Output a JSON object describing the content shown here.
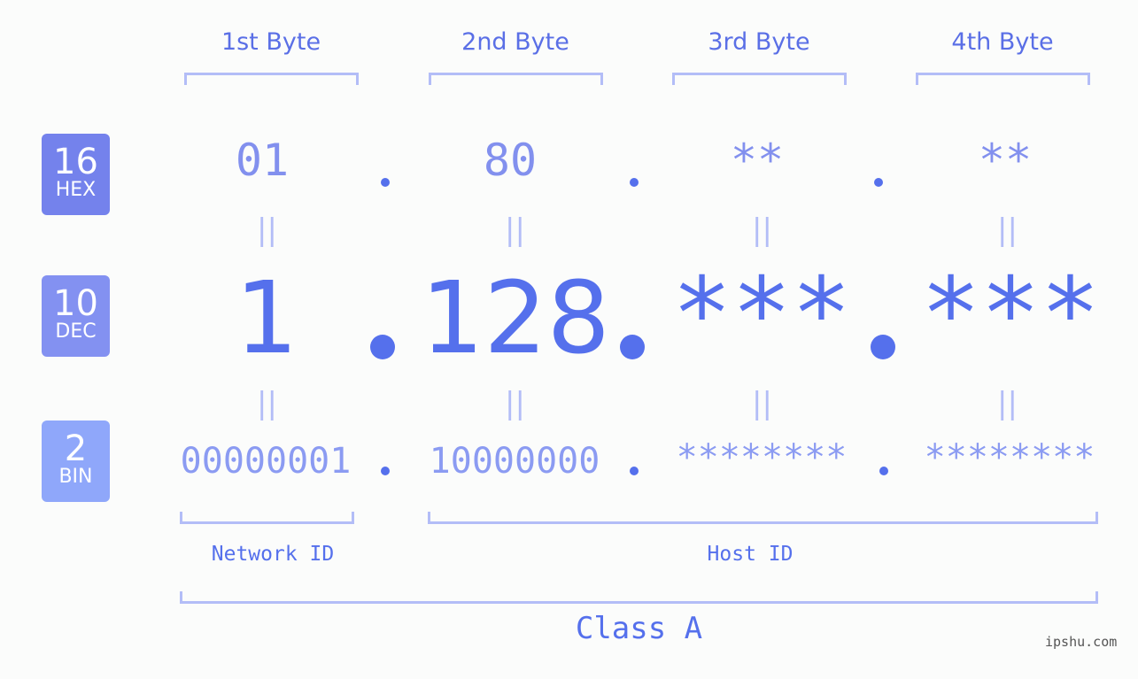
{
  "badges": [
    {
      "number": "16",
      "label": "HEX",
      "color": "#7482ec"
    },
    {
      "number": "10",
      "label": "DEC",
      "color": "#8391f1"
    },
    {
      "number": "2",
      "label": "BIN",
      "color": "#8fa7fa"
    }
  ],
  "byte_headers": [
    "1st Byte",
    "2nd Byte",
    "3rd Byte",
    "4th Byte"
  ],
  "hex": [
    "01",
    "80",
    "**",
    "**"
  ],
  "dec": [
    "1",
    "128",
    "***",
    "***"
  ],
  "bin": [
    "00000001",
    "10000000",
    "********",
    "********"
  ],
  "equals_glyph": "||",
  "network_label": "Network ID",
  "host_label": "Host ID",
  "class_label": "Class A",
  "watermark": "ipshu.com",
  "colors": {
    "accent": "#5570ec",
    "bracket": "#b3bdf7",
    "hex_text": "#8290ee",
    "bin_text": "#8b9bf2",
    "background": "#fbfcfb"
  }
}
